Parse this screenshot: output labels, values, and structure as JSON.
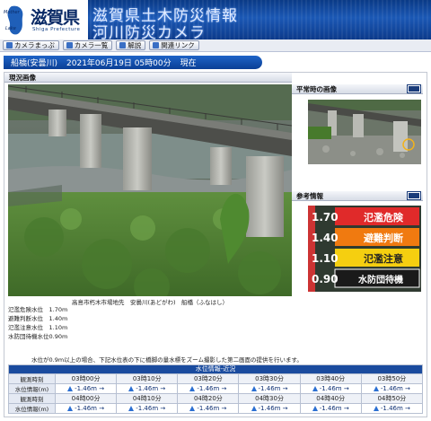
{
  "header": {
    "logo_text": "滋賀県",
    "logo_sub": "Shiga Prefecture",
    "emblem_label_top": "Mother",
    "emblem_label_bottom": "Lake",
    "title_line1": "滋賀県土木防災情報",
    "title_line2": "河川防災カメラ"
  },
  "nav": {
    "items": [
      {
        "label": "カメラまっぷ",
        "icon": "map-icon"
      },
      {
        "label": "カメラ一覧",
        "icon": "list-icon"
      },
      {
        "label": "解説",
        "icon": "info-icon"
      },
      {
        "label": "関連リンク",
        "icon": "link-icon"
      }
    ]
  },
  "titlebar": {
    "station": "船橋(安曇川)",
    "datetime": "2021年06月19日 05時00分",
    "status": "現在"
  },
  "main": {
    "current_heading": "現況画像",
    "normal_heading": "平常時の画像",
    "reference_heading": "参考情報",
    "caption": "高島市朽木市場地先　安曇川(あどがわ)　船橋（ふなはし）",
    "levels": [
      "氾濫危険水位　1.70m",
      "避難判断水位　1.40m",
      "氾濫注意水位　1.10m",
      "水防団待機水位0.90m"
    ],
    "note": "水位が0.9m以上の場合、下記水位表の下に橋脚の量水標をズーム撮影した第二画面の提供を行います。",
    "reference_levels": [
      {
        "value": "1.70",
        "label": "氾濫危険",
        "color": "#e02a2a"
      },
      {
        "value": "1.40",
        "label": "避難判断",
        "color": "#f07a10"
      },
      {
        "value": "1.10",
        "label": "氾濫注意",
        "color": "#f5cf10"
      },
      {
        "value": "0.90",
        "label": "水防団待機",
        "color": "#1a1a1a"
      }
    ]
  },
  "table": {
    "caption": "水位情報-近況",
    "time_label": "観測時刻",
    "value_label": "水位情報(m)",
    "rows": [
      {
        "times": [
          "03時00分",
          "03時10分",
          "03時20分",
          "03時30分",
          "03時40分",
          "03時50分"
        ],
        "values": [
          "-1.46m →",
          "-1.46m →",
          "-1.46m →",
          "-1.46m →",
          "-1.46m →",
          "-1.46m →"
        ]
      },
      {
        "times": [
          "04時00分",
          "04時10分",
          "04時20分",
          "04時30分",
          "04時40分",
          "04時50分"
        ],
        "values": [
          "-1.46m →",
          "-1.46m →",
          "-1.46m →",
          "-1.46m →",
          "-1.46m →",
          "-1.46m →"
        ]
      }
    ]
  }
}
